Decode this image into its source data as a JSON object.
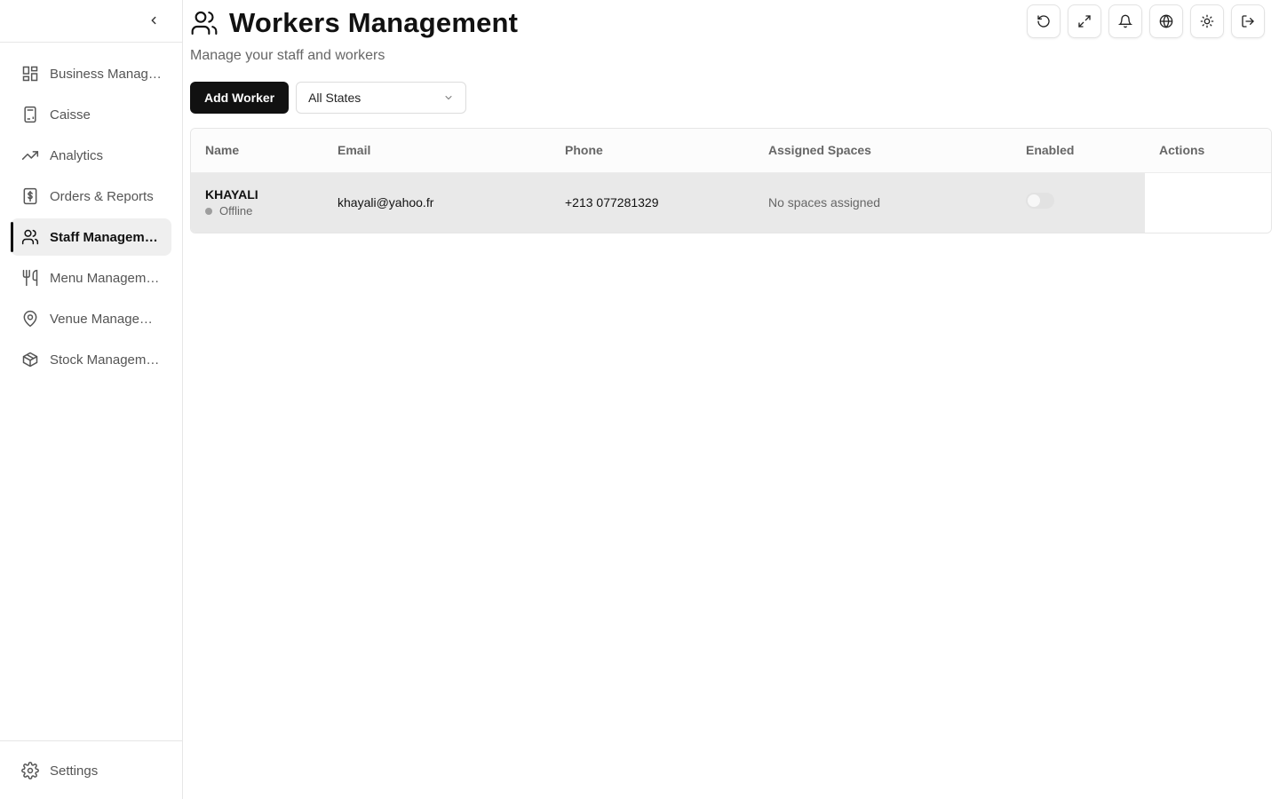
{
  "sidebar": {
    "collapse_icon": "chevron-left-icon",
    "items": [
      {
        "label": "Business Management",
        "icon": "dashboard-icon"
      },
      {
        "label": "Caisse",
        "icon": "calculator-icon"
      },
      {
        "label": "Analytics",
        "icon": "trending-up-icon"
      },
      {
        "label": "Orders & Reports",
        "icon": "receipt-dollar-icon"
      },
      {
        "label": "Staff Management",
        "icon": "users-icon",
        "active": true
      },
      {
        "label": "Menu Management",
        "icon": "utensils-icon"
      },
      {
        "label": "Venue Management",
        "icon": "map-pin-icon"
      },
      {
        "label": "Stock Management",
        "icon": "package-icon"
      }
    ],
    "settings": {
      "label": "Settings",
      "icon": "gear-icon"
    }
  },
  "header": {
    "title": "Workers Management",
    "subtitle": "Manage your staff and workers",
    "title_icon": "users-icon"
  },
  "top_actions": [
    "refresh-icon",
    "expand-icon",
    "bell-icon",
    "globe-icon",
    "sun-icon",
    "logout-icon"
  ],
  "toolbar": {
    "add_label": "Add Worker",
    "filter_value": "All States"
  },
  "table": {
    "columns": [
      "Name",
      "Email",
      "Phone",
      "Assigned Spaces",
      "Enabled",
      "Actions"
    ],
    "rows": [
      {
        "name": "KHAYALI",
        "status": "Offline",
        "email": "khayali@yahoo.fr",
        "phone": "+213 077281329",
        "spaces": "No spaces assigned",
        "enabled": false
      }
    ]
  },
  "colors": {
    "primary": "#111111",
    "row_highlight": "#e9e9e9",
    "status_offline": "#9e9e9e"
  }
}
